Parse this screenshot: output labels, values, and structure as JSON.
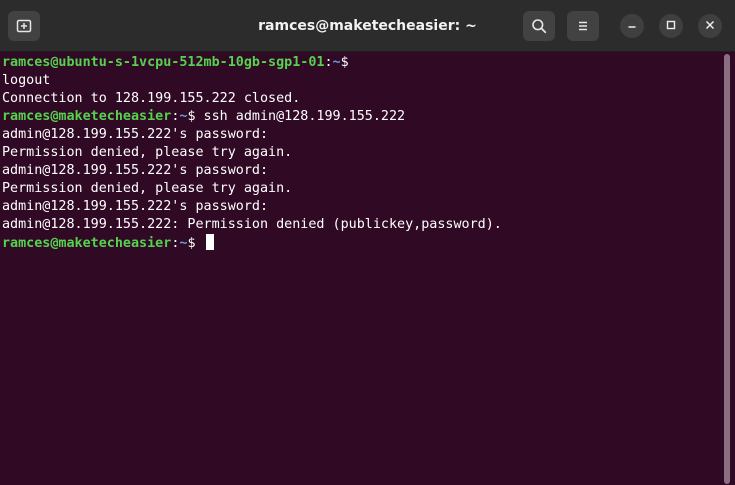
{
  "window": {
    "title": "ramces@maketecheasier: ~"
  },
  "header": {
    "new_tab_icon": "new-tab-icon",
    "search_icon": "search-icon",
    "menu_icon": "hamburger-menu-icon",
    "minimize_icon": "minimize-icon",
    "maximize_icon": "maximize-icon",
    "close_icon": "close-icon"
  },
  "terminal": {
    "prompt1": {
      "user": "ramces@ubuntu-s-1vcpu-512mb-10gb-sgp1-01",
      "colon": ":",
      "path": "~",
      "symbol": "$",
      "command": ""
    },
    "line_logout": "logout",
    "line_closed": "Connection to 128.199.155.222 closed.",
    "prompt2": {
      "user": "ramces@maketecheasier",
      "colon": ":",
      "path": "~",
      "symbol": "$",
      "command": " ssh admin@128.199.155.222"
    },
    "output": [
      "admin@128.199.155.222's password:",
      "Permission denied, please try again.",
      "admin@128.199.155.222's password:",
      "Permission denied, please try again.",
      "admin@128.199.155.222's password:",
      "admin@128.199.155.222: Permission denied (publickey,password)."
    ],
    "prompt3": {
      "user": "ramces@maketecheasier",
      "colon": ":",
      "path": "~",
      "symbol": "$",
      "command": " "
    }
  },
  "colors": {
    "background": "#300a24",
    "prompt_user": "#55d24e",
    "prompt_path": "#6a9be2",
    "text": "#ffffff",
    "titlebar": "#2c2c2c"
  }
}
